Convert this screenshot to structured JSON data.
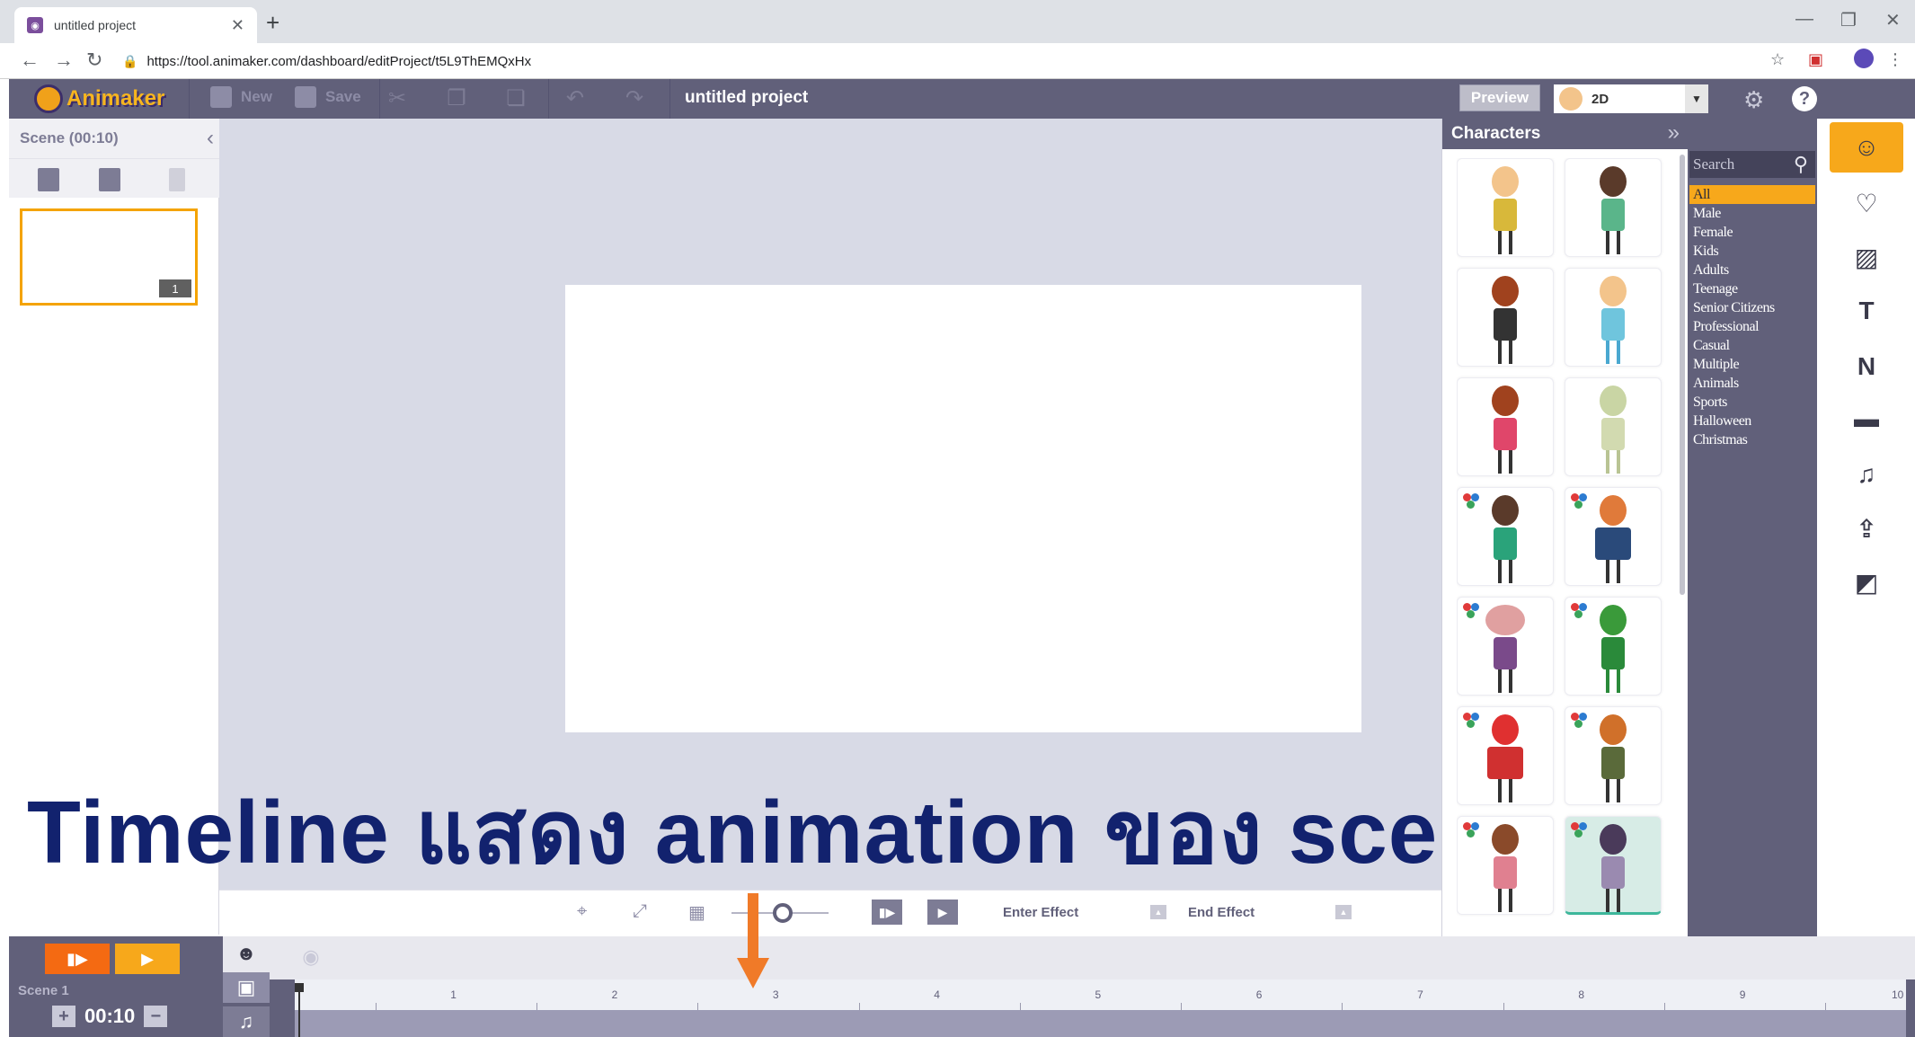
{
  "browser": {
    "tab_title": "untitled project",
    "url": "https://tool.animaker.com/dashboard/editProject/t5L9ThEMQxHx"
  },
  "toolbar": {
    "logo_text": "Animaker",
    "new_label": "New",
    "save_label": "Save",
    "project_title": "untitled project",
    "preview_label": "Preview",
    "mode_label": "2D"
  },
  "scene_panel": {
    "header": "Scene  (00:10)",
    "thumb_number": "1"
  },
  "overlay_caption": "Timeline แสดง animation ของ scene นี้",
  "controls": {
    "enter_effect": "Enter Effect",
    "end_effect": "End Effect"
  },
  "characters": {
    "header": "Characters",
    "search_placeholder": "Search",
    "categories": [
      "All",
      "Male",
      "Female",
      "Kids",
      "Adults",
      "Teenage",
      "Senior Citizens",
      "Professional",
      "Casual",
      "Multiple",
      "Animals",
      "Sports",
      "Halloween",
      "Christmas"
    ],
    "active_category": "All"
  },
  "timeline": {
    "scene_label": "Scene 1",
    "duration": "00:10",
    "ticks": [
      "1",
      "2",
      "3",
      "4",
      "5",
      "6",
      "7",
      "8",
      "9",
      "10"
    ]
  },
  "colors": {
    "toolbar_bg": "#61607a",
    "accent_orange": "#f7a81b",
    "play_orange": "#f46a12",
    "overlay_text": "#12226e",
    "arrow": "#f07a28"
  }
}
